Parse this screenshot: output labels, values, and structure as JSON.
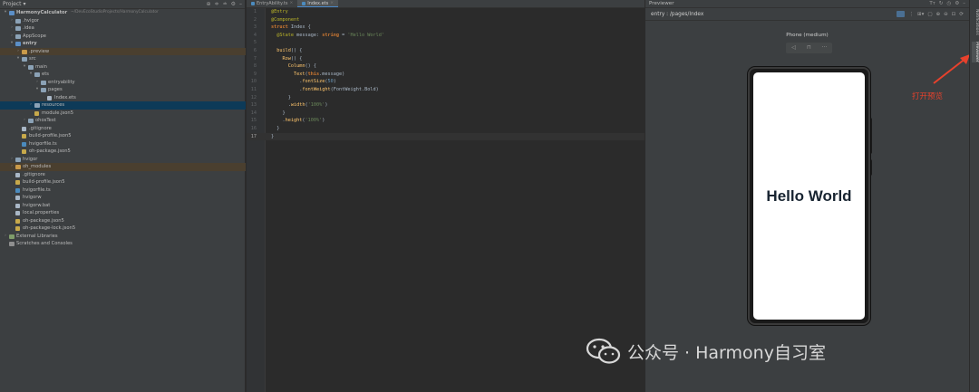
{
  "project_panel": {
    "title": "Project",
    "tree": [
      {
        "indent": 0,
        "arrow": "▾",
        "icon": "folder-blue",
        "label": "HarmonyCalculator",
        "hint": "~/DevEcoStudioProjects/HarmonyCalculator",
        "bold": true
      },
      {
        "indent": 1,
        "arrow": "›",
        "icon": "folder",
        "label": ".hvigor"
      },
      {
        "indent": 1,
        "arrow": "›",
        "icon": "folder",
        "label": ".idea"
      },
      {
        "indent": 1,
        "arrow": "›",
        "icon": "folder",
        "label": "AppScope"
      },
      {
        "indent": 1,
        "arrow": "▾",
        "icon": "folder-blue",
        "label": "entry",
        "bold": true
      },
      {
        "indent": 2,
        "arrow": "›",
        "icon": "folder-orange",
        "label": ".preview",
        "state": "excluded"
      },
      {
        "indent": 2,
        "arrow": "▾",
        "icon": "folder",
        "label": "src"
      },
      {
        "indent": 3,
        "arrow": "▾",
        "icon": "folder",
        "label": "main"
      },
      {
        "indent": 4,
        "arrow": "▾",
        "icon": "folder",
        "label": "ets"
      },
      {
        "indent": 5,
        "arrow": "›",
        "icon": "folder",
        "label": "entryability"
      },
      {
        "indent": 5,
        "arrow": "▾",
        "icon": "folder",
        "label": "pages"
      },
      {
        "indent": 6,
        "arrow": "",
        "icon": "file",
        "label": "Index.ets"
      },
      {
        "indent": 4,
        "arrow": "›",
        "icon": "folder",
        "label": "resources",
        "state": "sel"
      },
      {
        "indent": 4,
        "arrow": "",
        "icon": "file-json",
        "label": "module.json5"
      },
      {
        "indent": 3,
        "arrow": "›",
        "icon": "folder",
        "label": "ohosTest"
      },
      {
        "indent": 2,
        "arrow": "",
        "icon": "file",
        "label": ".gitignore"
      },
      {
        "indent": 2,
        "arrow": "",
        "icon": "file-json",
        "label": "build-profile.json5"
      },
      {
        "indent": 2,
        "arrow": "",
        "icon": "file-ts",
        "label": "hvigorfile.ts"
      },
      {
        "indent": 2,
        "arrow": "",
        "icon": "file-json",
        "label": "oh-package.json5"
      },
      {
        "indent": 1,
        "arrow": "›",
        "icon": "folder",
        "label": "hvigor"
      },
      {
        "indent": 1,
        "arrow": "›",
        "icon": "folder-orange",
        "label": "oh_modules",
        "state": "excluded"
      },
      {
        "indent": 1,
        "arrow": "",
        "icon": "file",
        "label": ".gitignore"
      },
      {
        "indent": 1,
        "arrow": "",
        "icon": "file-json",
        "label": "build-profile.json5"
      },
      {
        "indent": 1,
        "arrow": "",
        "icon": "file-ts",
        "label": "hvigorfile.ts"
      },
      {
        "indent": 1,
        "arrow": "",
        "icon": "file",
        "label": "hvigorw"
      },
      {
        "indent": 1,
        "arrow": "",
        "icon": "file",
        "label": "hvigorw.bat"
      },
      {
        "indent": 1,
        "arrow": "",
        "icon": "file",
        "label": "local.properties"
      },
      {
        "indent": 1,
        "arrow": "",
        "icon": "file-json",
        "label": "oh-package.json5"
      },
      {
        "indent": 1,
        "arrow": "",
        "icon": "file-json",
        "label": "oh-package-lock.json5"
      },
      {
        "indent": 0,
        "arrow": "›",
        "icon": "lib",
        "label": "External Libraries"
      },
      {
        "indent": 0,
        "arrow": "",
        "icon": "scratch",
        "label": "Scratches and Consoles"
      }
    ]
  },
  "editor": {
    "tabs": [
      {
        "label": "EntryAbility.ts",
        "active": false
      },
      {
        "label": "Index.ets",
        "active": true
      }
    ],
    "lines": [
      [
        [
          "dec",
          "@Entry"
        ]
      ],
      [
        [
          "dec",
          "@Component"
        ]
      ],
      [
        [
          "kw",
          "struct "
        ],
        [
          "plain",
          "Index {"
        ]
      ],
      [
        [
          "plain",
          "  "
        ],
        [
          "dec",
          "@State "
        ],
        [
          "plain",
          "message: "
        ],
        [
          "kw",
          "string "
        ],
        [
          "plain",
          "= "
        ],
        [
          "str",
          "'Hello World'"
        ]
      ],
      [],
      [
        [
          "plain",
          "  "
        ],
        [
          "fn",
          "build"
        ],
        [
          "plain",
          "() {"
        ]
      ],
      [
        [
          "plain",
          "    "
        ],
        [
          "fn",
          "Row"
        ],
        [
          "plain",
          "() {"
        ]
      ],
      [
        [
          "plain",
          "      "
        ],
        [
          "fn",
          "Column"
        ],
        [
          "plain",
          "() {"
        ]
      ],
      [
        [
          "plain",
          "        "
        ],
        [
          "fn",
          "Text"
        ],
        [
          "plain",
          "("
        ],
        [
          "kw",
          "this"
        ],
        [
          "plain",
          ".message)"
        ]
      ],
      [
        [
          "plain",
          "          ."
        ],
        [
          "fn",
          "fontSize"
        ],
        [
          "plain",
          "("
        ],
        [
          "num",
          "50"
        ],
        [
          "plain",
          ")"
        ]
      ],
      [
        [
          "plain",
          "          ."
        ],
        [
          "fn",
          "fontWeight"
        ],
        [
          "plain",
          "(FontWeight.Bold)"
        ]
      ],
      [
        [
          "plain",
          "      }"
        ]
      ],
      [
        [
          "plain",
          "      ."
        ],
        [
          "fn",
          "width"
        ],
        [
          "plain",
          "("
        ],
        [
          "str",
          "'100%'"
        ],
        [
          "plain",
          ")"
        ]
      ],
      [
        [
          "plain",
          "    }"
        ]
      ],
      [
        [
          "plain",
          "    ."
        ],
        [
          "fn",
          "height"
        ],
        [
          "plain",
          "("
        ],
        [
          "str",
          "'100%'"
        ],
        [
          "plain",
          ")"
        ]
      ],
      [
        [
          "plain",
          "  }"
        ]
      ],
      [
        [
          "plain",
          "}"
        ]
      ]
    ],
    "current_line": 17
  },
  "previewer": {
    "title": "Previewer",
    "path": "entry : /pages/Index",
    "device": "Phone (medium)",
    "device_controls": [
      "◁",
      "⊓",
      "···"
    ],
    "screen_text": "Hello World"
  },
  "annotation": {
    "text": "打开预览",
    "color": "#e8412c"
  },
  "right_strip": {
    "tabs": [
      {
        "label": "Notifications",
        "active": false
      },
      {
        "label": "Previewer",
        "active": true
      }
    ]
  },
  "watermark": {
    "text": "公众号 · Harmony自习室"
  }
}
